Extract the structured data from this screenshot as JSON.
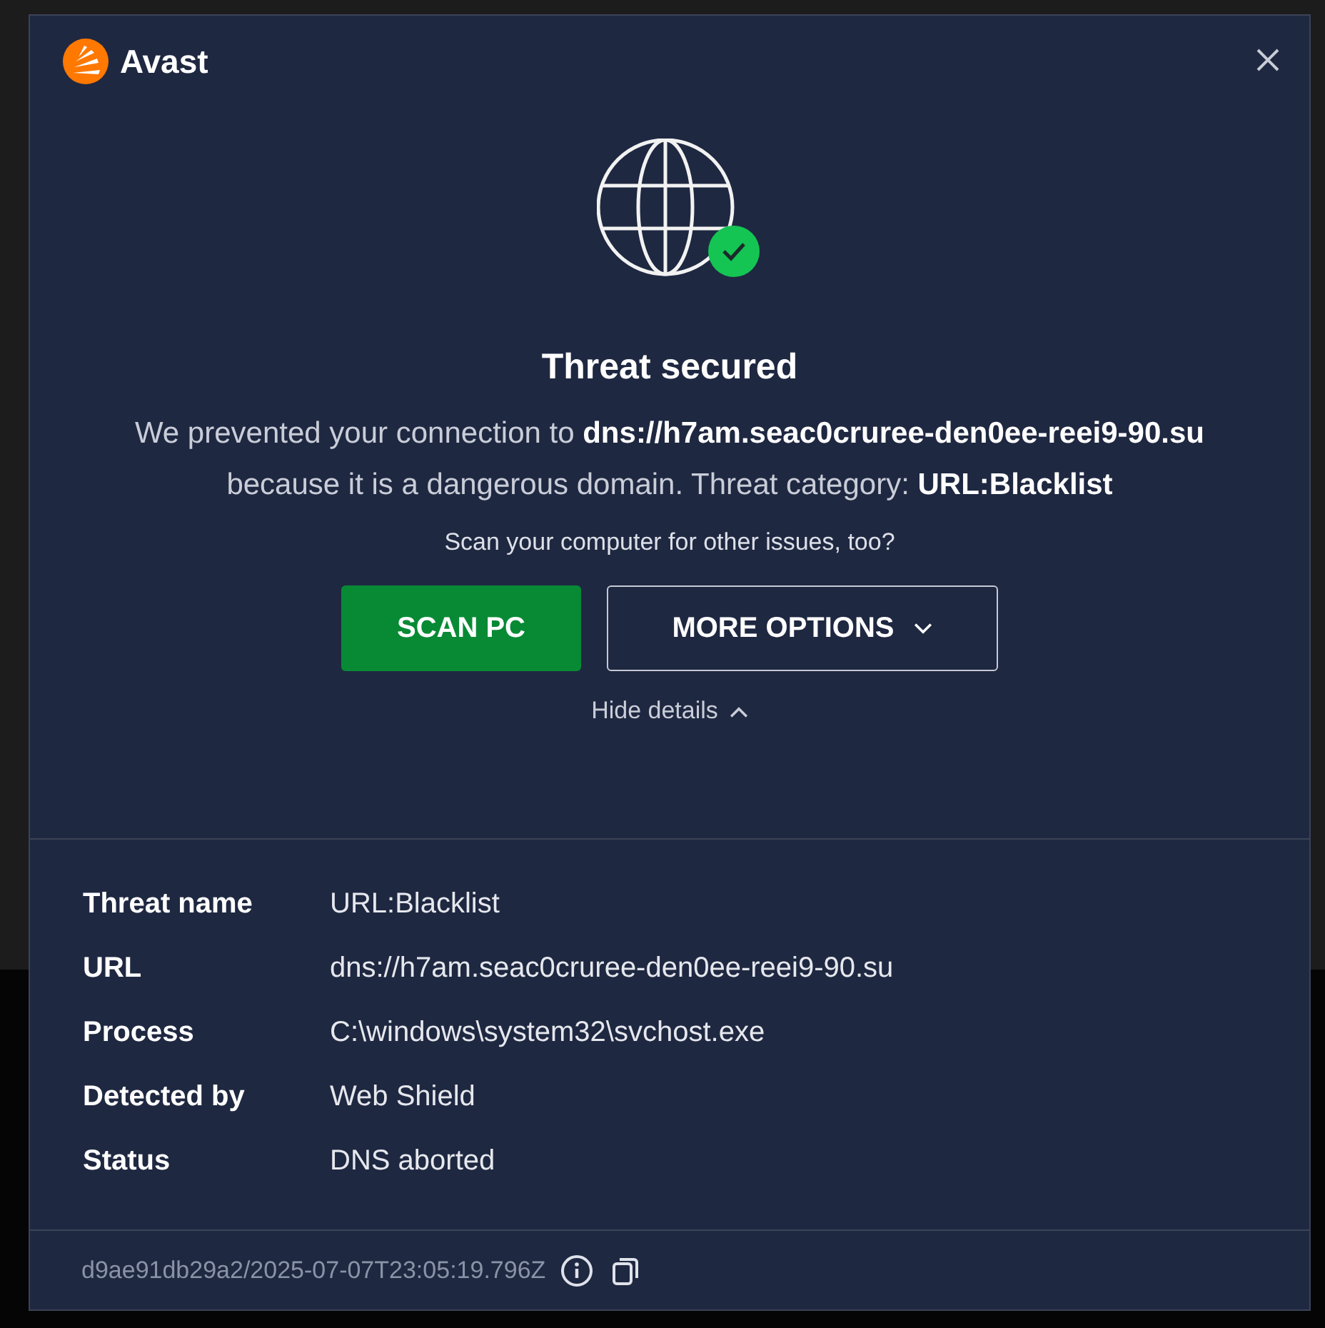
{
  "brand": {
    "name": "Avast"
  },
  "headline": "Threat secured",
  "message": "We prevented your connection to **dns://h7am.seac0cruree-den0ee-reei9-90.su** because it is a dangerous domain. Threat category: **URL:Blacklist**",
  "prompt": "Scan your computer for other issues, too?",
  "buttons": [
    {
      "label": "SCAN PC",
      "kind": "primary"
    },
    {
      "label": "MORE OPTIONS",
      "kind": "dropdown"
    }
  ],
  "details_toggle": {
    "label": "Hide details",
    "expanded": true
  },
  "details": [
    {
      "label": "Threat name",
      "value": "URL:Blacklist"
    },
    {
      "label": "URL",
      "value": "dns://h7am.seac0cruree-den0ee-reei9-90.su"
    },
    {
      "label": "Process",
      "value": "C:\\windows\\system32\\svchost.exe"
    },
    {
      "label": "Detected by",
      "value": "Web Shield"
    },
    {
      "label": "Status",
      "value": "DNS aborted"
    }
  ],
  "footer": {
    "id": "d9ae91db29a2/2025-07-07T23:05:19.796Z"
  }
}
